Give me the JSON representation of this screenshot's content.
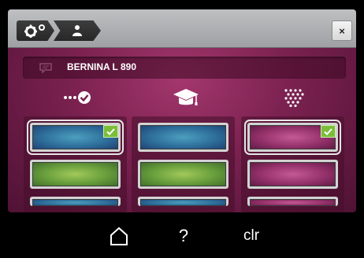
{
  "topbar": {
    "crumbs": [
      {
        "icon": "settings-gears-icon"
      },
      {
        "icon": "user-icon"
      }
    ],
    "close_label": "×"
  },
  "machine": {
    "icon": "message-icon",
    "name": "BERNINA L 890"
  },
  "columns": [
    {
      "icon": "dots-check-icon",
      "tiles": [
        "blue",
        "green"
      ],
      "selected": "blue"
    },
    {
      "icon": "graduation-cap-icon",
      "tiles": [
        "blue",
        "green"
      ],
      "selected": null
    },
    {
      "icon": "dot-pattern-icon",
      "tiles": [
        "pink",
        "pink"
      ],
      "selected": "pink"
    }
  ],
  "bottom_nav": {
    "home_icon": "home-icon",
    "help_label": "?",
    "clear_label": "clr"
  },
  "colors": {
    "background": "#7a2150",
    "check_green": "#7bbd3a"
  }
}
